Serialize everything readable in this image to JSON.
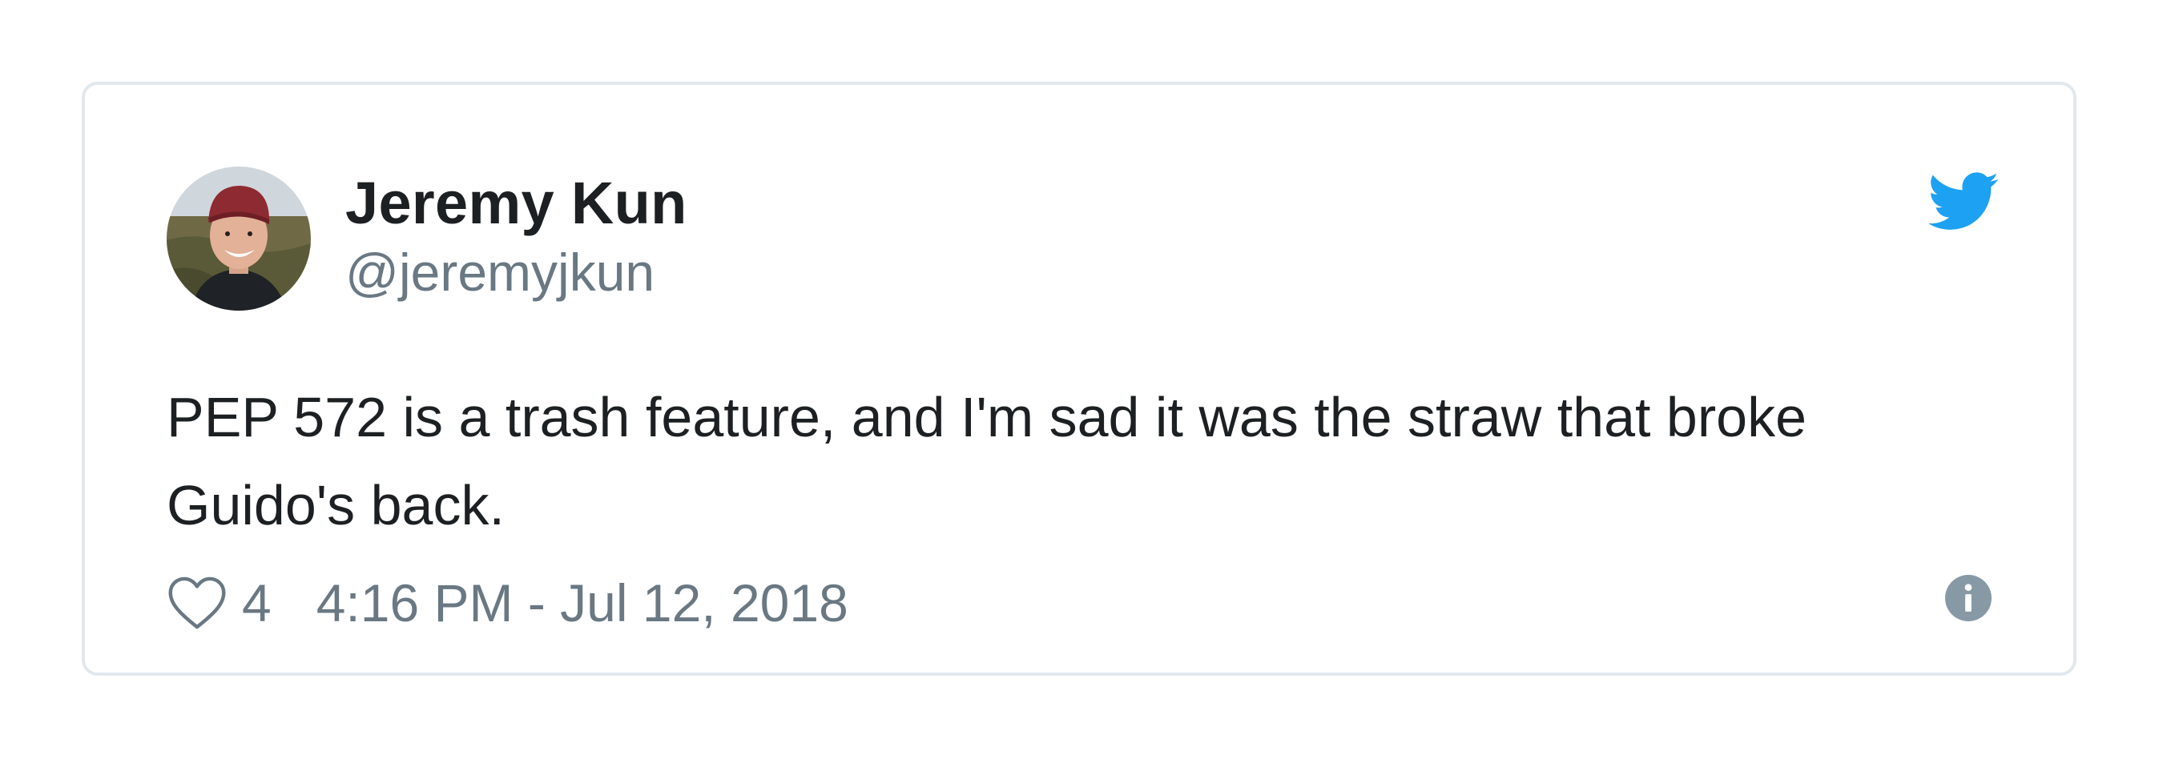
{
  "tweet": {
    "author_name": "Jeremy Kun",
    "author_handle": "@jeremyjkun",
    "text": "PEP 572 is a trash feature, and I'm sad it was the straw that broke Guido's back.",
    "like_count": "4",
    "timestamp": "4:16 PM - Jul 12, 2018"
  },
  "icons": {
    "brand": "twitter-bird-icon",
    "like": "heart-icon",
    "info": "info-icon"
  },
  "colors": {
    "twitter_blue": "#1da1f2",
    "text_primary": "#1c2022",
    "text_secondary": "#697882",
    "border": "#e1e8ed"
  }
}
